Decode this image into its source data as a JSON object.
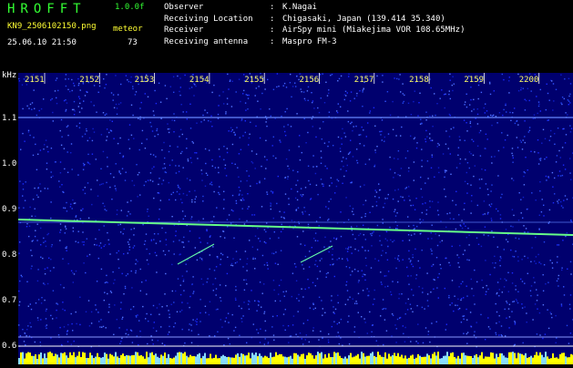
{
  "header": {
    "logo": "HROFFT",
    "version": "1.0.0f",
    "filename": "KN9_2506102150.png",
    "meteor_label": "meteor",
    "datetime": "25.06.10 21:50",
    "meteor_count": "73"
  },
  "info": [
    {
      "label": "Observer",
      "sep": ":",
      "value": "K.Nagai"
    },
    {
      "label": "Receiving Location",
      "sep": ":",
      "value": "Chigasaki, Japan (139.414 35.340)"
    },
    {
      "label": "Receiver",
      "sep": ":",
      "value": "AirSpy mini (Miakejima VOR 108.65MHz)"
    },
    {
      "label": "Receiving antenna",
      "sep": ":",
      "value": "Maspro FM-3"
    }
  ],
  "axis": {
    "unit": "kHz",
    "y_ticks": [
      "1.1",
      "1.0",
      "0.9",
      "0.8",
      "0.7",
      "0.6"
    ],
    "time_ticks": [
      "2151",
      "2152",
      "2153",
      "2154",
      "2155",
      "2156",
      "2157",
      "2158",
      "2159",
      "2200"
    ]
  },
  "colors": {
    "background": "#00006e",
    "noise": "#2244ff",
    "carrier": "#66ff88",
    "header_green": "#33ff33",
    "header_yellow": "#ffff33",
    "bottom_band": "#ffff00"
  }
}
